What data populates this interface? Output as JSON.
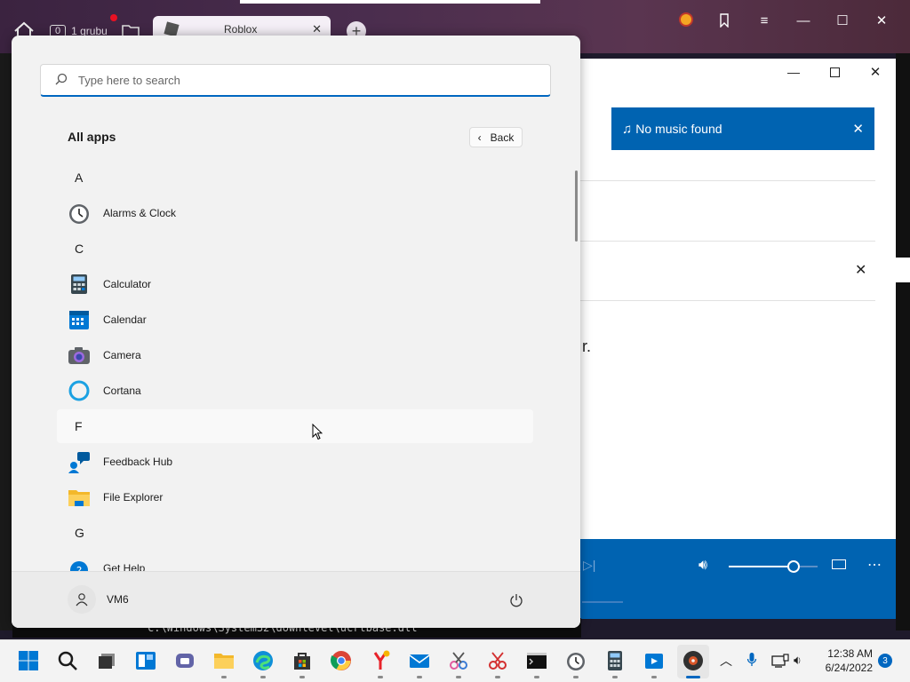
{
  "browser": {
    "tab_group": "0",
    "tab_group_label": "1 grubu",
    "tab_title": "Roblox",
    "controls": {
      "minimize": "—",
      "maximize": "☐",
      "close": "✕"
    }
  },
  "music": {
    "notice": "No music found",
    "partial_text": "r."
  },
  "console": {
    "text": "c:\\Windows\\System32\\downlevel\\ucrtbase.dll"
  },
  "start_menu": {
    "search_placeholder": "Type here to search",
    "all_apps": "All apps",
    "back": "Back",
    "sections": [
      {
        "letter": "A",
        "apps": [
          "Alarms & Clock"
        ]
      },
      {
        "letter": "C",
        "apps": [
          "Calculator",
          "Calendar",
          "Camera",
          "Cortana"
        ]
      },
      {
        "letter": "F",
        "apps": [
          "Feedback Hub",
          "File Explorer"
        ]
      },
      {
        "letter": "G",
        "apps": [
          "Get Help"
        ]
      }
    ],
    "user": "VM6"
  },
  "taskbar": {
    "time": "12:38 AM",
    "date": "6/24/2022",
    "notifications": "3"
  },
  "colors": {
    "accent": "#0067c0",
    "music_blue": "#0063b1"
  }
}
